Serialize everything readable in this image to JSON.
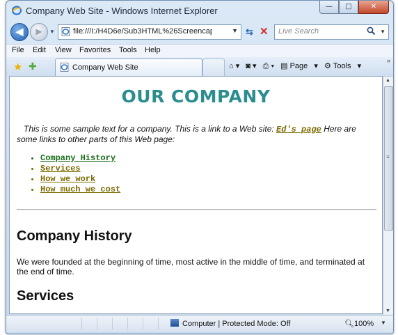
{
  "window": {
    "title": "Company Web Site - Windows Internet Explorer"
  },
  "nav": {
    "address": "file:///I:/H4D6e/Sub3HTML%26Screencaps",
    "search_placeholder": "Live Search"
  },
  "menu": [
    "File",
    "Edit",
    "View",
    "Favorites",
    "Tools",
    "Help"
  ],
  "tab": {
    "label": "Company Web Site"
  },
  "toolbar": {
    "page_label": "Page",
    "tools_label": "Tools"
  },
  "page": {
    "heading": "OUR COMPANY",
    "intro_before": "This is some sample text for a company. This is a link to a Web site: ",
    "intro_link": "Ed's page",
    "intro_after": " Here are some links to other parts of this Web page:",
    "links": [
      {
        "label": "Company History",
        "color": "#1b6d1b"
      },
      {
        "label": "Services",
        "color": "#7a6a00"
      },
      {
        "label": "How we work",
        "color": "#7a6a00"
      },
      {
        "label": "How much we cost",
        "color": "#7a6a00"
      }
    ],
    "section1_heading": "Company History",
    "section1_text": "We were founded at the beginning of time, most active in the middle of time, and terminated at the end of time.",
    "section2_heading": "Services"
  },
  "status": {
    "zone": "Computer | Protected Mode: Off",
    "zoom": "100%"
  }
}
